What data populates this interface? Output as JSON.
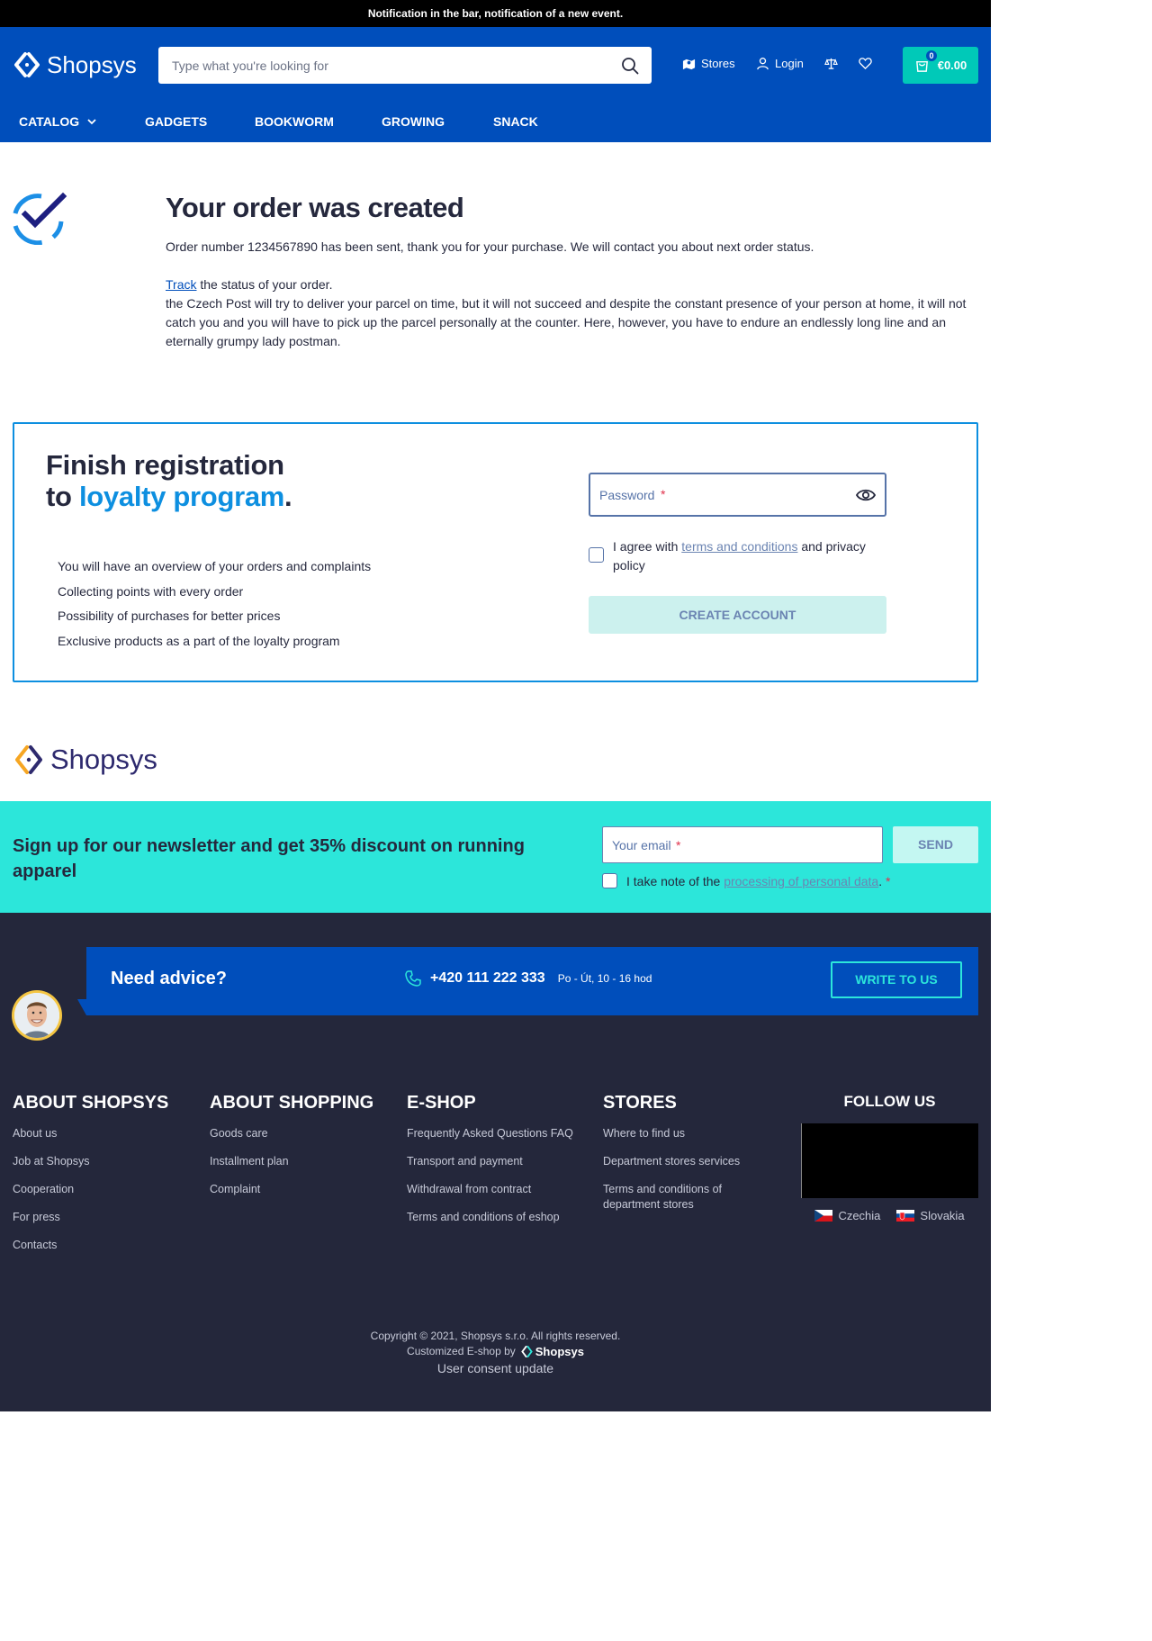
{
  "notification": "Notification in the bar, notification of a new event.",
  "header": {
    "logo_text": "Shopsys",
    "search_placeholder": "Type what you're looking for",
    "stores_label": "Stores",
    "login_label": "Login",
    "cart_count": "0",
    "cart_total": "€0.00"
  },
  "menu": {
    "items": [
      "CATALOG",
      "GADGETS",
      "BOOKWORM",
      "GROWING",
      "SNACK"
    ]
  },
  "order": {
    "title": "Your order was created",
    "message": "Order number 1234567890 has been sent, thank you for your purchase. We will contact you about next order status.",
    "track_link": "Track",
    "track_rest": " the status of your order.",
    "post_text": "the Czech Post will try to deliver your parcel on time, but it will not succeed and despite the constant presence of your person at home, it will not catch you and you will have to pick up the parcel personally at the counter. Here, however, you have to endure an endlessly long line and an eternally grumpy lady postman."
  },
  "registration": {
    "title_1": "Finish registration to ",
    "title_highlight": "loyalty program",
    "title_end": ".",
    "benefits": [
      "You will have an overview of your orders and complaints",
      "Collecting points with every order",
      "Possibility of purchases for better prices",
      "Exclusive products as a part of the loyalty program"
    ],
    "password_placeholder": "Password",
    "required_mark": "*",
    "agree_prefix": "I agree with ",
    "agree_link": "terms and conditions",
    "agree_suffix": " and privacy policy",
    "create_button": "CREATE ACCOUNT"
  },
  "footer_logo": "Shopsys",
  "newsletter": {
    "title": "Sign up for our newsletter and get 35% discount on running apparel",
    "email_placeholder": "Your email",
    "required_mark": "*",
    "send_button": "SEND",
    "consent_prefix": "I take note of the ",
    "consent_link": "processing of personal data",
    "consent_suffix": ". ",
    "consent_required": "*"
  },
  "advice": {
    "title": "Need advice?",
    "phone": "+420 111 222 333",
    "hours": "Po - Út, 10 - 16 hod",
    "write_button": "WRITE TO US"
  },
  "footer": {
    "columns": [
      {
        "title": "ABOUT SHOPSYS",
        "links": [
          "About us",
          "Job at Shopsys",
          "Cooperation",
          "For press",
          "Contacts"
        ]
      },
      {
        "title": "ABOUT SHOPPING",
        "links": [
          "Goods care",
          "Installment plan",
          "Complaint"
        ]
      },
      {
        "title": "E-SHOP",
        "links": [
          "Frequently Asked Questions FAQ",
          "Transport and payment",
          "Withdrawal from contract",
          "Terms and conditions of eshop"
        ]
      },
      {
        "title": "STORES",
        "links": [
          "Where to find us",
          "Department stores services",
          "Terms and conditions of department stores"
        ]
      }
    ],
    "follow_title": "FOLLOW US",
    "languages": [
      "Czechia",
      "Slovakia"
    ],
    "copyright": "Copyright © 2021, Shopsys s.r.o. All rights reserved.",
    "customized_by": "Customized E-shop by",
    "brand": "Shopsys",
    "consent_update": "User consent update"
  },
  "colors": {
    "brand_blue": "#004ebb",
    "accent_turquoise": "#00c9b8",
    "newsletter_bg": "#2ce6da",
    "footer_bg": "#24273b",
    "loyalty_blue": "#0d8fe0"
  }
}
